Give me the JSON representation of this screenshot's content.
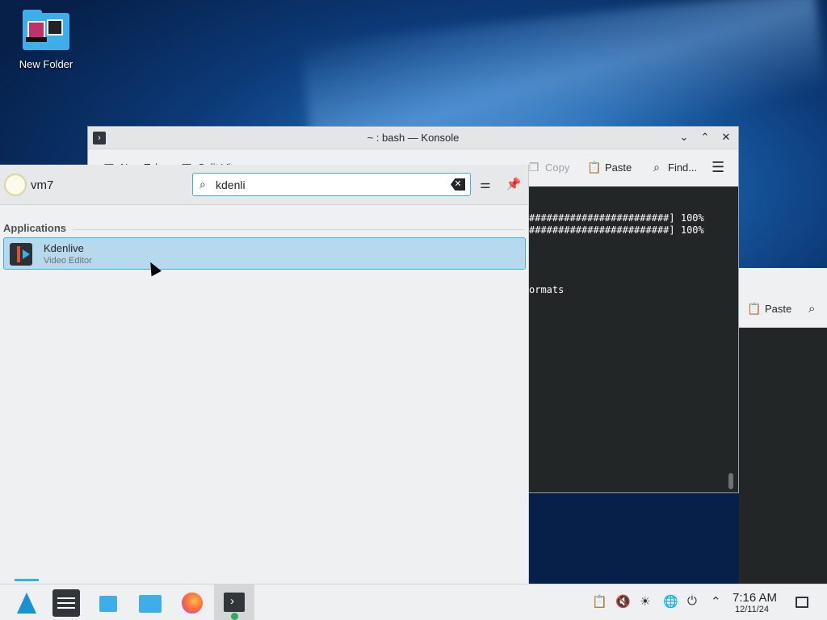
{
  "desktop": {
    "icon_label": "New Folder"
  },
  "konsole": {
    "title": "~ : bash — Konsole",
    "toolbar": {
      "new_tab": "New Tab",
      "split_view": "Split View",
      "copy": "Copy",
      "paste": "Paste",
      "find": "Find..."
    },
    "terminal_lines": [
      "########################] 100%",
      "########################] 100%",
      "ormats"
    ]
  },
  "background_window": {
    "paste": "Paste"
  },
  "launcher": {
    "username": "vm7",
    "search": {
      "value": "kdenli"
    },
    "section_title": "Applications",
    "results": [
      {
        "name": "Kdenlive",
        "description": "Video Editor"
      }
    ]
  },
  "taskbar": {
    "clock_time": "7:16 AM",
    "clock_date": "12/11/24"
  },
  "icons": {
    "search": "search-icon",
    "clear": "clear-icon",
    "configure": "configure-icon",
    "pin": "pin-icon",
    "hamburger": "menu-icon"
  }
}
